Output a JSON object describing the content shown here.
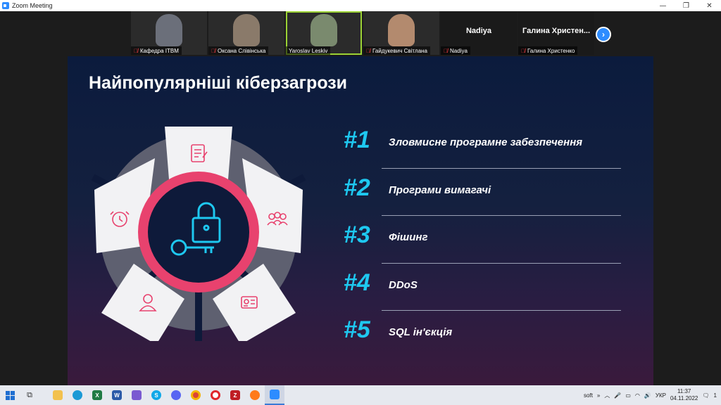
{
  "window": {
    "title": "Zoom Meeting",
    "minimize": "—",
    "restore": "❐",
    "close": "✕"
  },
  "participants": [
    {
      "name": "Кафедра ІТВМ",
      "muted": true,
      "avatar_color": "#6b6f7a"
    },
    {
      "name": "Оксана Слівінська",
      "muted": true,
      "avatar_color": "#8a7a6a"
    },
    {
      "name": "Yaroslav Leskiv",
      "muted": false,
      "avatar_color": "#7a8a6e",
      "active": true
    },
    {
      "name": "Гайдукевич Світлана",
      "muted": true,
      "avatar_color": "#b38a6e"
    },
    {
      "name": "Nadiya",
      "muted": true,
      "display": "Nadiya"
    },
    {
      "name": "Галина Христенко",
      "muted": true,
      "display": "Галина Христен..."
    }
  ],
  "slide": {
    "title": "Найпопулярніші кіберзагрози",
    "threats": [
      {
        "rank": "#1",
        "label": "Зловмисне програмне забезпечення"
      },
      {
        "rank": "#2",
        "label": "Програми вимагачі"
      },
      {
        "rank": "#3",
        "label": "Фішинг"
      },
      {
        "rank": "#4",
        "label": "DDoS"
      },
      {
        "rank": "#5",
        "label": "SQL ін'єкція"
      }
    ],
    "accent": "#1ec8f0",
    "ring_color": "#e8426e"
  },
  "taskbar": {
    "tray_label": "soft",
    "tray_chevron": "»",
    "language": "УКР",
    "time": "11:37",
    "date": "04.11.2022",
    "notification_count": "1"
  }
}
